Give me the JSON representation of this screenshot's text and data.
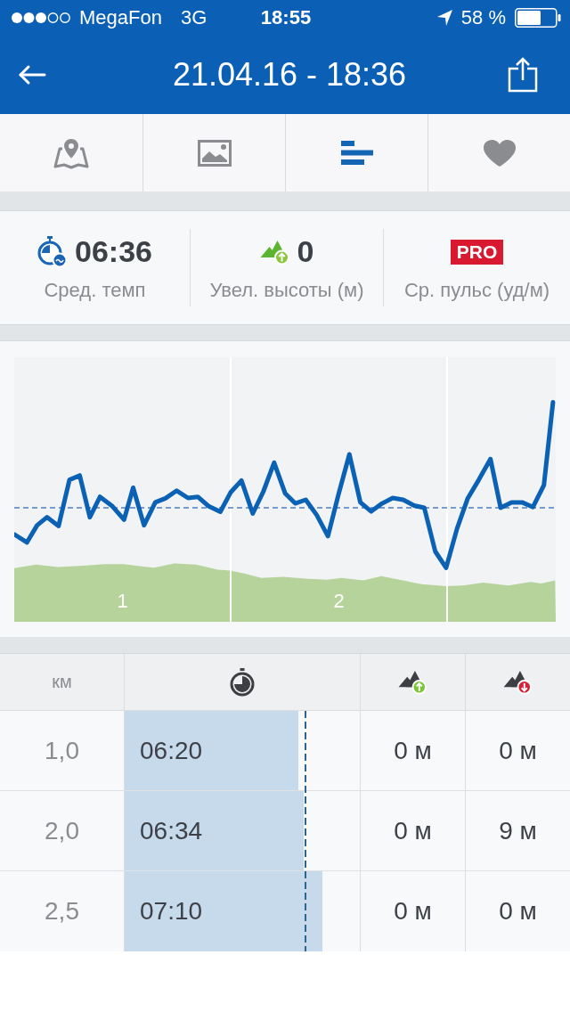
{
  "status_bar": {
    "carrier": "MegaFon",
    "network": "3G",
    "time": "18:55",
    "battery": "58 %"
  },
  "header": {
    "title": "21.04.16 - 18:36"
  },
  "tabs": [
    {
      "kind": "map",
      "selected": false
    },
    {
      "kind": "photo",
      "selected": false
    },
    {
      "kind": "splits",
      "selected": true
    },
    {
      "kind": "heart",
      "selected": false
    }
  ],
  "stats": [
    {
      "kind": "pace",
      "value": "06:36",
      "label": "Сред. темп"
    },
    {
      "kind": "ascent",
      "value": "0",
      "label": "Увел. высоты (м)"
    },
    {
      "kind": "pro",
      "badge": "PRO",
      "label": "Ср. пульс (уд/м)"
    }
  ],
  "chart": {
    "segment_labels": [
      "1",
      "2"
    ]
  },
  "table": {
    "columns": [
      {
        "kind": "text",
        "label": "км"
      },
      {
        "kind": "pace"
      },
      {
        "kind": "ascent"
      },
      {
        "kind": "descent"
      }
    ],
    "average": {
      "level": 0.77
    },
    "rows": [
      {
        "km": "1,0",
        "pace": "06:20",
        "level": 0.74,
        "ascent": "0 м",
        "descent": "0 м"
      },
      {
        "km": "2,0",
        "pace": "06:34",
        "level": 0.76,
        "ascent": "0 м",
        "descent": "9 м"
      },
      {
        "km": "2,5",
        "pace": "07:10",
        "level": 0.84,
        "ascent": "0 м",
        "descent": "0 м"
      }
    ]
  }
}
